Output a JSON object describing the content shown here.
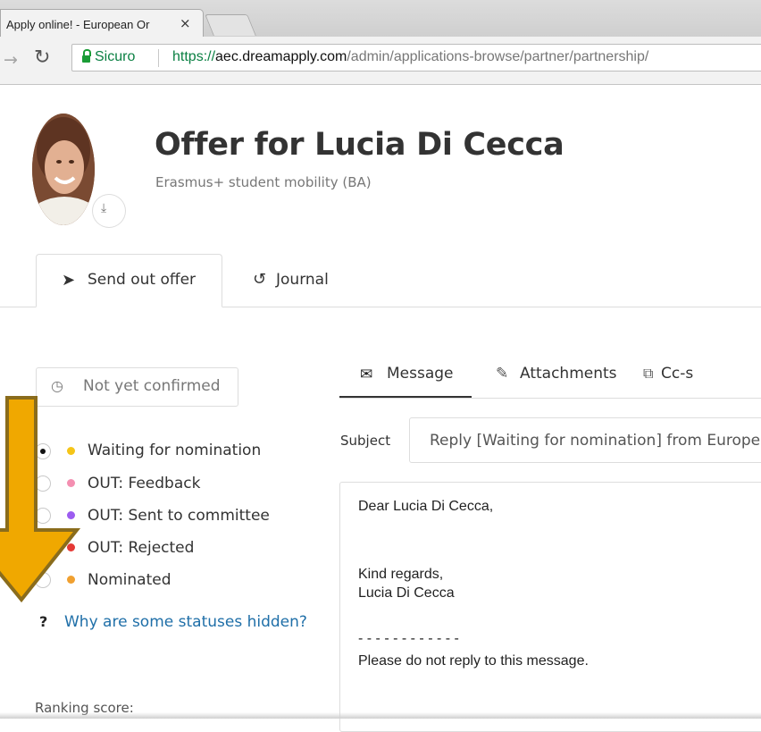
{
  "browser": {
    "tab_title": "Apply online! - European Or",
    "tab_close": "×",
    "secure_label": "Sicuro",
    "url_scheme": "https://",
    "url_host": "aec.dreamapply.com",
    "url_path": "/admin/applications-browse/partner/partnership/"
  },
  "profile": {
    "title": "Offer for Lucia Di Cecca",
    "subtitle": "Erasmus+ student mobility (BA)"
  },
  "tabs": [
    {
      "label": "Send out offer",
      "icon": "paper-plane-icon",
      "active": true
    },
    {
      "label": "Journal",
      "icon": "history-icon",
      "active": false
    }
  ],
  "confirmation": {
    "label": "Not yet confirmed",
    "icon": "clock-icon"
  },
  "statuses": [
    {
      "label": "Waiting for nomination",
      "color": "#f5c518",
      "checked": true
    },
    {
      "label": "OUT: Feedback",
      "color": "#f48fb1",
      "checked": false
    },
    {
      "label": "OUT: Sent to committee",
      "color": "#9c5cf0",
      "checked": false
    },
    {
      "label": "OUT: Rejected",
      "color": "#e53935",
      "checked": false
    },
    {
      "label": "Nominated",
      "color": "#f0a030",
      "checked": false
    }
  ],
  "help": {
    "label": "Why are some statuses hidden?"
  },
  "ranking_label": "Ranking score:",
  "message_tabs": [
    {
      "label": "Message",
      "icon": "envelope-icon",
      "active": true
    },
    {
      "label": "Attachments",
      "icon": "paperclip-icon",
      "active": false
    },
    {
      "label": "Cc-s",
      "icon": "copy-icon",
      "active": false
    }
  ],
  "subject": {
    "label": "Subject",
    "value": "Reply [Waiting for nomination] from European"
  },
  "body": {
    "greeting": "Dear Lucia Di Cecca,",
    "closing": "Kind regards,",
    "signature": "Lucia Di Cecca",
    "separator": "- - - - - - - - - - - -",
    "notice": "Please do not reply to this message."
  },
  "colors": {
    "link": "#1f6fa8",
    "arrow_fill": "#f0a800",
    "arrow_stroke": "#8a6c1c",
    "secure_green": "#0b8043"
  }
}
